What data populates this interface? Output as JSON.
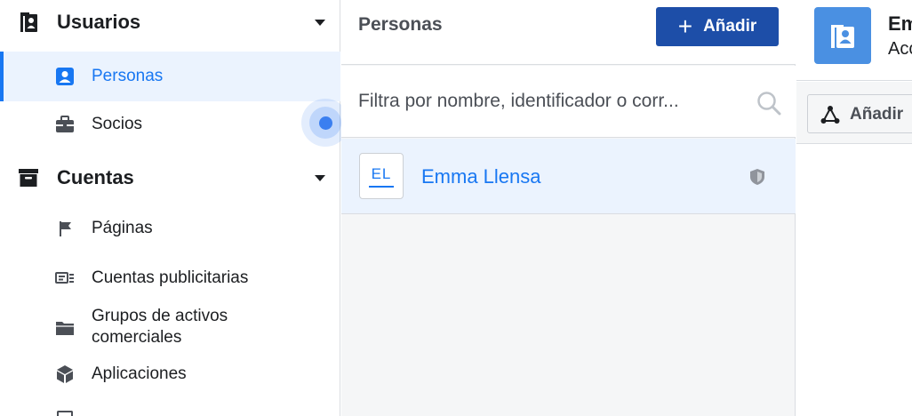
{
  "sidebar": {
    "sections": [
      {
        "label": "Usuarios",
        "icon": "users-book-icon",
        "items": [
          {
            "label": "Personas",
            "icon": "person-card-icon",
            "active": true
          },
          {
            "label": "Socios",
            "icon": "briefcase-icon",
            "active": false
          }
        ]
      },
      {
        "label": "Cuentas",
        "icon": "archive-box-icon",
        "items": [
          {
            "label": "Páginas",
            "icon": "flag-icon"
          },
          {
            "label": "Cuentas publicitarias",
            "icon": "ad-account-icon"
          },
          {
            "label": "Grupos de activos comerciales",
            "label_line1": "Grupos de activos",
            "label_line2": "comerciales",
            "icon": "folder-icon"
          },
          {
            "label": "Aplicaciones",
            "icon": "cube-icon"
          }
        ]
      }
    ]
  },
  "middle": {
    "title": "Personas",
    "add_button": {
      "plus": "+",
      "label": "Añadir"
    },
    "search": {
      "placeholder": "Filtra por nombre, identificador o corr..."
    },
    "people": [
      {
        "initials": "EL",
        "name": "Emma Llensa",
        "badge": "shield-icon"
      }
    ]
  },
  "detail": {
    "name": "Em",
    "subtitle": "Acc",
    "assign_button": {
      "label": "Añadir"
    }
  },
  "colors": {
    "accent": "#1877f2",
    "primary_button": "#1d4ea8",
    "active_bg": "#ebf3fe",
    "avatar_bg": "#4a90e2"
  }
}
